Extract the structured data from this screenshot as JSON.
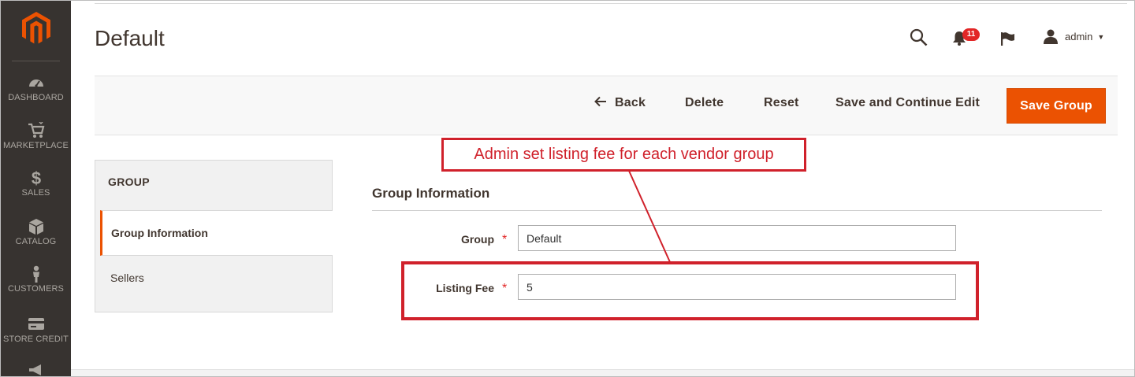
{
  "sidebar": {
    "items": [
      {
        "label": "DASHBOARD",
        "icon": "speedometer-icon"
      },
      {
        "label": "MARKETPLACE",
        "icon": "cart-icon"
      },
      {
        "label": "SALES",
        "icon": "dollar-icon"
      },
      {
        "label": "CATALOG",
        "icon": "box-icon"
      },
      {
        "label": "CUSTOMERS",
        "icon": "person-icon"
      },
      {
        "label": "STORE CREDIT",
        "icon": "credit-card-icon"
      }
    ]
  },
  "header": {
    "title": "Default",
    "notification_count": "11",
    "user_name": "admin"
  },
  "actions": {
    "back": "Back",
    "delete": "Delete",
    "reset": "Reset",
    "save_continue": "Save and Continue Edit",
    "save": "Save Group"
  },
  "tabs": {
    "heading": "GROUP",
    "items": [
      "Group Information",
      "Sellers"
    ]
  },
  "form": {
    "section_title": "Group Information",
    "fields": [
      {
        "label": "Group",
        "value": "Default"
      },
      {
        "label": "Listing Fee",
        "value": "5"
      }
    ]
  },
  "annotation": {
    "text": "Admin set listing fee for each vendor group"
  },
  "colors": {
    "accent": "#eb5202",
    "sidebar": "#373330",
    "annotation": "#d0212b"
  }
}
